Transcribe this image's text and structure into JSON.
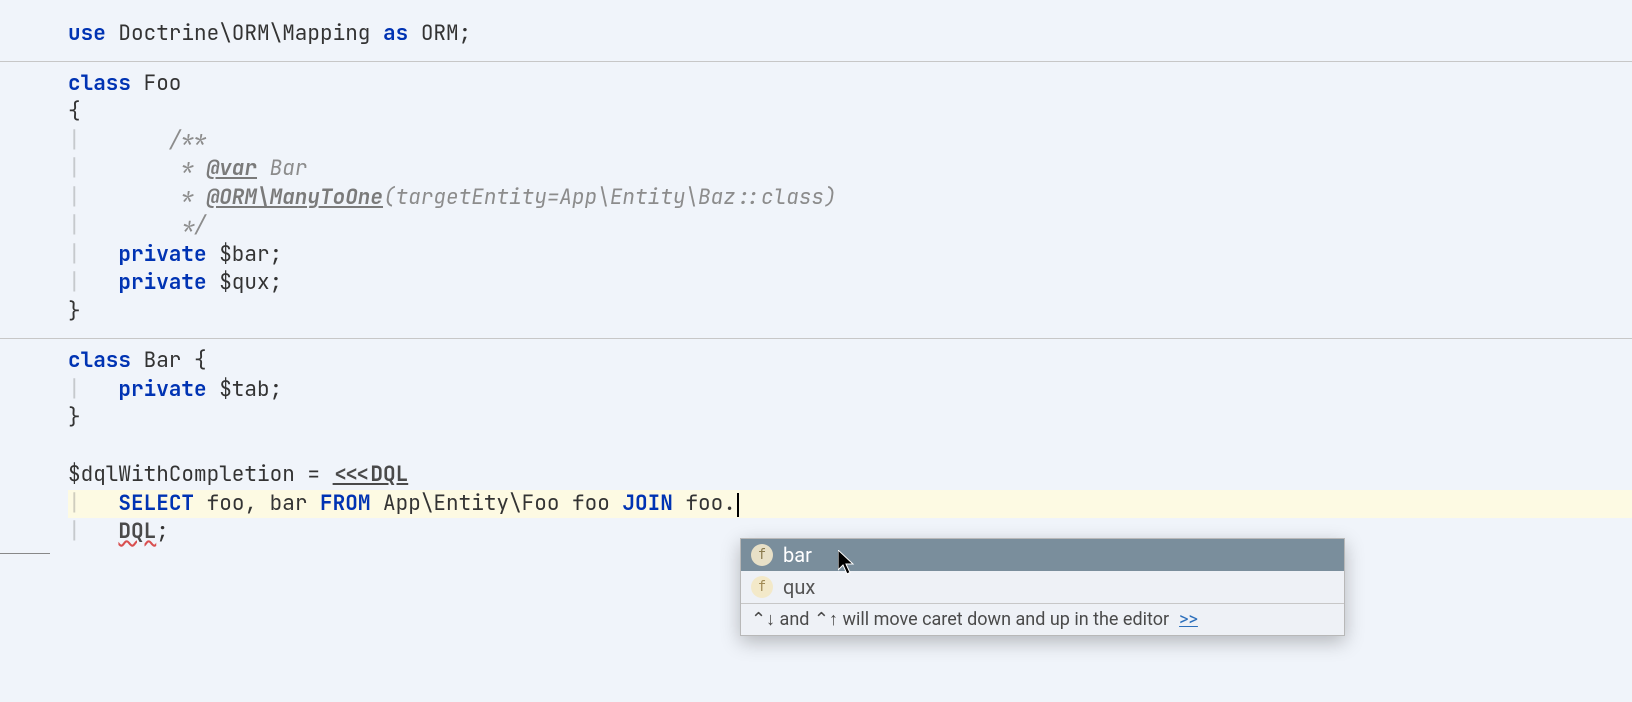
{
  "code": {
    "l1": {
      "use": "use",
      "pkg": " Doctrine\\ORM\\Mapping ",
      "as": "as",
      "alias": " ORM;"
    },
    "l2": {
      "class": "class",
      "name": " Foo"
    },
    "l3": "{",
    "l4": "    /**",
    "l5_pre": "     * ",
    "l5_ann": "@var",
    "l5_post": " Bar",
    "l6_pre": "     * ",
    "l6_ann": "@ORM\\ManyToOne",
    "l6_post": "(targetEntity=App\\Entity\\Baz::class)",
    "l7": "     */",
    "l8": {
      "priv": "private",
      "var": " $bar;"
    },
    "l9": {
      "priv": "private",
      "var": " $qux;"
    },
    "l10": "}",
    "l11": {
      "class": "class",
      "name": " Bar {"
    },
    "l12": {
      "priv": "private",
      "var": " $tab;"
    },
    "l13": "}",
    "l14": {
      "var": "$dqlWithCompletion = ",
      "heredoc": "<<<DQL"
    },
    "l15": {
      "indent": "    ",
      "select": "SELECT",
      "mid1": " foo, bar ",
      "from": "FROM",
      "mid2": " App\\Entity\\Foo foo ",
      "join": "JOIN",
      "tail": " foo."
    },
    "l16": {
      "indent": "    ",
      "end": "DQL",
      "semi": ";"
    }
  },
  "completion": {
    "items": [
      {
        "icon": "f",
        "label": "bar"
      },
      {
        "icon": "f",
        "label": "qux"
      }
    ],
    "hint_prefix": "⌃↓ and ⌃↑ will move caret down and up in the editor",
    "hint_link": ">>"
  }
}
